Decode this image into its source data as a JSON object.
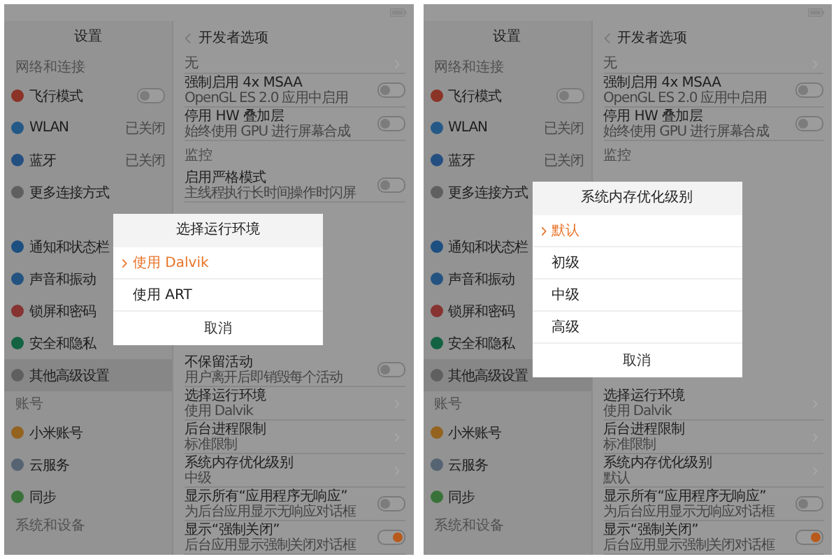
{
  "panels": [
    {
      "sidebar": {
        "title": "设置",
        "sections": [
          {
            "heading": "网络和连接",
            "items": [
              {
                "label": "飞行模式",
                "color": "#8b3327",
                "kind": "toggle",
                "on": false,
                "selected": false
              },
              {
                "label": "WLAN",
                "color": "#245987",
                "kind": "value",
                "value": "已关闭",
                "selected": false
              },
              {
                "label": "蓝牙",
                "color": "#244f81",
                "kind": "value",
                "value": "已关闭",
                "selected": false
              },
              {
                "label": "更多连接方式",
                "color": "#5f5f5f",
                "kind": "plain",
                "selected": false
              }
            ]
          },
          {
            "items": [
              {
                "label": "通知和状态栏",
                "color": "#1d4f80",
                "kind": "plain",
                "selected": false
              },
              {
                "label": "声音和振动",
                "color": "#245381",
                "kind": "plain",
                "selected": false
              },
              {
                "label": "锁屏和密码",
                "color": "#863331",
                "kind": "plain",
                "selected": false
              },
              {
                "label": "安全和隐私",
                "color": "#136342",
                "kind": "plain",
                "selected": false
              },
              {
                "label": "其他高级设置",
                "color": "#5f5f5f",
                "kind": "plain",
                "selected": true
              }
            ]
          },
          {
            "heading": "账号",
            "items": [
              {
                "label": "小米账号",
                "color": "#956320",
                "kind": "plain",
                "selected": false
              },
              {
                "label": "云服务",
                "color": "#556372",
                "kind": "plain",
                "selected": false
              },
              {
                "label": "同步",
                "color": "#397239",
                "kind": "plain",
                "selected": false
              }
            ]
          },
          {
            "heading": "系统和设备"
          }
        ]
      },
      "content": {
        "title": "开发者选项",
        "rows_top": [
          {
            "kind": "link",
            "subtitle": "无"
          },
          {
            "kind": "toggle",
            "title": "强制启用 4x MSAA",
            "subtitle": "OpenGL ES 2.0 应用中启用",
            "on": false
          },
          {
            "kind": "toggle",
            "title": "停用 HW 叠加层",
            "subtitle": "始终使用 GPU 进行屏幕合成",
            "on": false
          },
          {
            "kind": "section",
            "title": "监控"
          },
          {
            "kind": "toggle",
            "title": "启用严格模式",
            "subtitle": "主线程执行长时间操作时闪屏",
            "on": false
          }
        ],
        "rows_bottom": [
          {
            "kind": "toggle",
            "title": "不保留活动",
            "subtitle": "用户离开后即销毁每个活动",
            "on": false
          },
          {
            "kind": "link",
            "title": "选择运行环境",
            "subtitle": "使用 Dalvik"
          },
          {
            "kind": "link",
            "title": "后台进程限制",
            "subtitle": "标准限制"
          },
          {
            "kind": "link",
            "title": "系统内存优化级别",
            "subtitle": "中级"
          },
          {
            "kind": "toggle",
            "title": "显示所有“应用程序无响应”",
            "subtitle": "为后台应用显示无响应对话框",
            "on": false
          },
          {
            "kind": "toggle",
            "title": "显示“强制关闭”",
            "subtitle": "后台应用显示强制关闭对话框",
            "on": true
          }
        ]
      },
      "dialog": {
        "title": "选择运行环境",
        "options": [
          {
            "label": "使用 Dalvik",
            "selected": true
          },
          {
            "label": "使用 ART",
            "selected": false
          }
        ],
        "cancel": "取消"
      }
    },
    {
      "sidebar": {
        "title": "设置",
        "sections": [
          {
            "heading": "网络和连接",
            "items": [
              {
                "label": "飞行模式",
                "color": "#8b3327",
                "kind": "toggle",
                "on": false,
                "selected": false
              },
              {
                "label": "WLAN",
                "color": "#245987",
                "kind": "value",
                "value": "已关闭",
                "selected": false
              },
              {
                "label": "蓝牙",
                "color": "#244f81",
                "kind": "value",
                "value": "已关闭",
                "selected": false
              },
              {
                "label": "更多连接方式",
                "color": "#5f5f5f",
                "kind": "plain",
                "selected": false
              }
            ]
          },
          {
            "items": [
              {
                "label": "通知和状态栏",
                "color": "#1d4f80",
                "kind": "plain",
                "selected": false
              },
              {
                "label": "声音和振动",
                "color": "#245381",
                "kind": "plain",
                "selected": false
              },
              {
                "label": "锁屏和密码",
                "color": "#863331",
                "kind": "plain",
                "selected": false
              },
              {
                "label": "安全和隐私",
                "color": "#136342",
                "kind": "plain",
                "selected": false
              },
              {
                "label": "其他高级设置",
                "color": "#5f5f5f",
                "kind": "plain",
                "selected": true
              }
            ]
          },
          {
            "heading": "账号",
            "items": [
              {
                "label": "小米账号",
                "color": "#956320",
                "kind": "plain",
                "selected": false
              },
              {
                "label": "云服务",
                "color": "#556372",
                "kind": "plain",
                "selected": false
              },
              {
                "label": "同步",
                "color": "#397239",
                "kind": "plain",
                "selected": false
              }
            ]
          },
          {
            "heading": "系统和设备"
          }
        ]
      },
      "content": {
        "title": "开发者选项",
        "rows_top": [
          {
            "kind": "link",
            "subtitle": "无"
          },
          {
            "kind": "toggle",
            "title": "强制启用 4x MSAA",
            "subtitle": "OpenGL ES 2.0 应用中启用",
            "on": false
          },
          {
            "kind": "toggle",
            "title": "停用 HW 叠加层",
            "subtitle": "始终使用 GPU 进行屏幕合成",
            "on": false
          },
          {
            "kind": "section",
            "title": "监控"
          }
        ],
        "rows_bottom": [
          {
            "kind": "link",
            "title": "选择运行环境",
            "subtitle": "使用 Dalvik"
          },
          {
            "kind": "link",
            "title": "后台进程限制",
            "subtitle": "标准限制"
          },
          {
            "kind": "link",
            "title": "系统内存优化级别",
            "subtitle": "默认"
          },
          {
            "kind": "toggle",
            "title": "显示所有“应用程序无响应”",
            "subtitle": "为后台应用显示无响应对话框",
            "on": false
          },
          {
            "kind": "toggle",
            "title": "显示“强制关闭”",
            "subtitle": "后台应用显示强制关闭对话框",
            "on": true
          }
        ]
      },
      "dialog": {
        "title": "系统内存优化级别",
        "options": [
          {
            "label": "默认",
            "selected": true
          },
          {
            "label": "初级",
            "selected": false
          },
          {
            "label": "中级",
            "selected": false
          },
          {
            "label": "高级",
            "selected": false
          }
        ],
        "cancel": "取消"
      }
    }
  ]
}
